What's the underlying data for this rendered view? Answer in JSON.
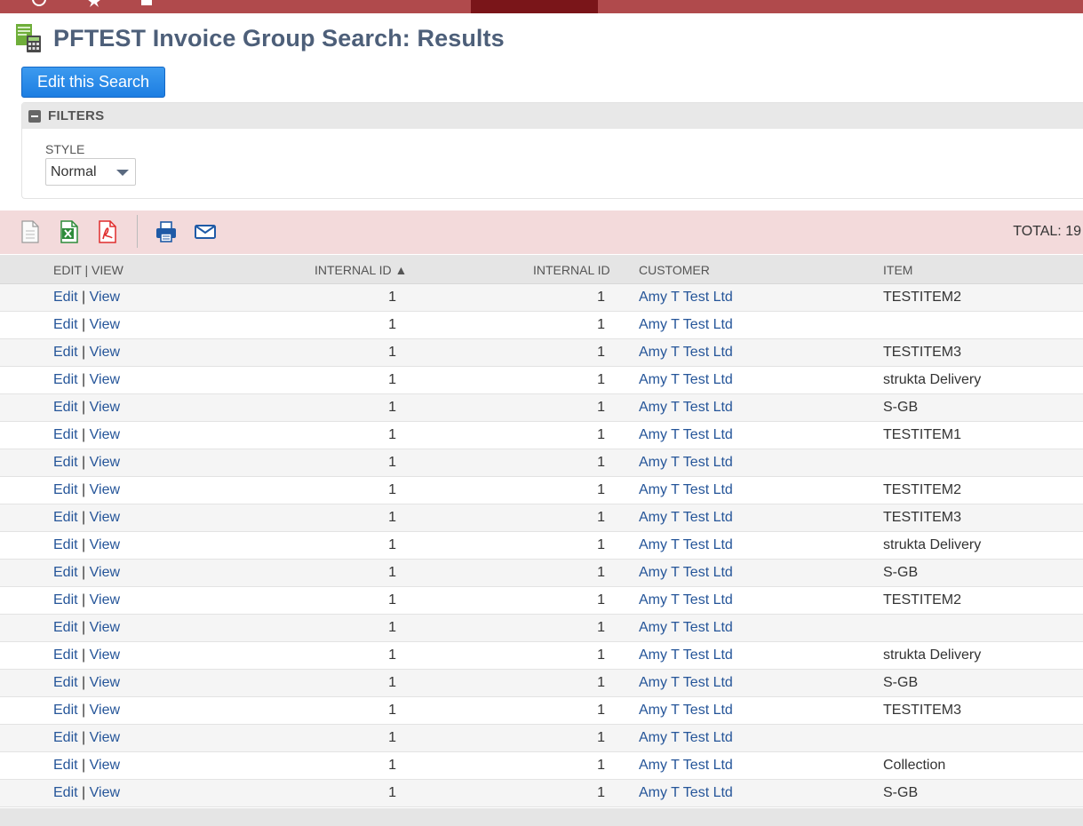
{
  "page": {
    "title": "PFTEST Invoice Group Search: Results",
    "edit_button": "Edit this Search"
  },
  "filters": {
    "heading": "FILTERS",
    "style_label": "STYLE",
    "style_value": "Normal"
  },
  "toolbar": {
    "icons": [
      "csv-export-icon",
      "excel-export-icon",
      "pdf-export-icon",
      "print-icon",
      "email-icon"
    ],
    "total": "TOTAL: 19"
  },
  "table": {
    "headers": {
      "edit_view": "EDIT | VIEW",
      "internal_id_sorted": "INTERNAL ID ▲",
      "internal_id": "INTERNAL ID",
      "customer": "CUSTOMER",
      "item": "ITEM"
    },
    "rows": [
      {
        "edit": "Edit",
        "view": "View",
        "id1": "1",
        "id2": "1",
        "customer": "Amy T Test Ltd",
        "item": "TESTITEM2"
      },
      {
        "edit": "Edit",
        "view": "View",
        "id1": "1",
        "id2": "1",
        "customer": "Amy T Test Ltd",
        "item": ""
      },
      {
        "edit": "Edit",
        "view": "View",
        "id1": "1",
        "id2": "1",
        "customer": "Amy T Test Ltd",
        "item": "TESTITEM3"
      },
      {
        "edit": "Edit",
        "view": "View",
        "id1": "1",
        "id2": "1",
        "customer": "Amy T Test Ltd",
        "item": "strukta Delivery"
      },
      {
        "edit": "Edit",
        "view": "View",
        "id1": "1",
        "id2": "1",
        "customer": "Amy T Test Ltd",
        "item": "S-GB"
      },
      {
        "edit": "Edit",
        "view": "View",
        "id1": "1",
        "id2": "1",
        "customer": "Amy T Test Ltd",
        "item": "TESTITEM1"
      },
      {
        "edit": "Edit",
        "view": "View",
        "id1": "1",
        "id2": "1",
        "customer": "Amy T Test Ltd",
        "item": ""
      },
      {
        "edit": "Edit",
        "view": "View",
        "id1": "1",
        "id2": "1",
        "customer": "Amy T Test Ltd",
        "item": "TESTITEM2"
      },
      {
        "edit": "Edit",
        "view": "View",
        "id1": "1",
        "id2": "1",
        "customer": "Amy T Test Ltd",
        "item": "TESTITEM3"
      },
      {
        "edit": "Edit",
        "view": "View",
        "id1": "1",
        "id2": "1",
        "customer": "Amy T Test Ltd",
        "item": "strukta Delivery"
      },
      {
        "edit": "Edit",
        "view": "View",
        "id1": "1",
        "id2": "1",
        "customer": "Amy T Test Ltd",
        "item": "S-GB"
      },
      {
        "edit": "Edit",
        "view": "View",
        "id1": "1",
        "id2": "1",
        "customer": "Amy T Test Ltd",
        "item": "TESTITEM2"
      },
      {
        "edit": "Edit",
        "view": "View",
        "id1": "1",
        "id2": "1",
        "customer": "Amy T Test Ltd",
        "item": ""
      },
      {
        "edit": "Edit",
        "view": "View",
        "id1": "1",
        "id2": "1",
        "customer": "Amy T Test Ltd",
        "item": "strukta Delivery"
      },
      {
        "edit": "Edit",
        "view": "View",
        "id1": "1",
        "id2": "1",
        "customer": "Amy T Test Ltd",
        "item": "S-GB"
      },
      {
        "edit": "Edit",
        "view": "View",
        "id1": "1",
        "id2": "1",
        "customer": "Amy T Test Ltd",
        "item": "TESTITEM3"
      },
      {
        "edit": "Edit",
        "view": "View",
        "id1": "1",
        "id2": "1",
        "customer": "Amy T Test Ltd",
        "item": ""
      },
      {
        "edit": "Edit",
        "view": "View",
        "id1": "1",
        "id2": "1",
        "customer": "Amy T Test Ltd",
        "item": "Collection"
      },
      {
        "edit": "Edit",
        "view": "View",
        "id1": "1",
        "id2": "1",
        "customer": "Amy T Test Ltd",
        "item": "S-GB"
      }
    ]
  },
  "colors": {
    "nav_bar": "#b04a4c",
    "nav_active": "#7a1519",
    "title": "#4d5f79",
    "button": "#1d7ee2",
    "link": "#255599",
    "toolbar_bg": "#f3dadb"
  }
}
